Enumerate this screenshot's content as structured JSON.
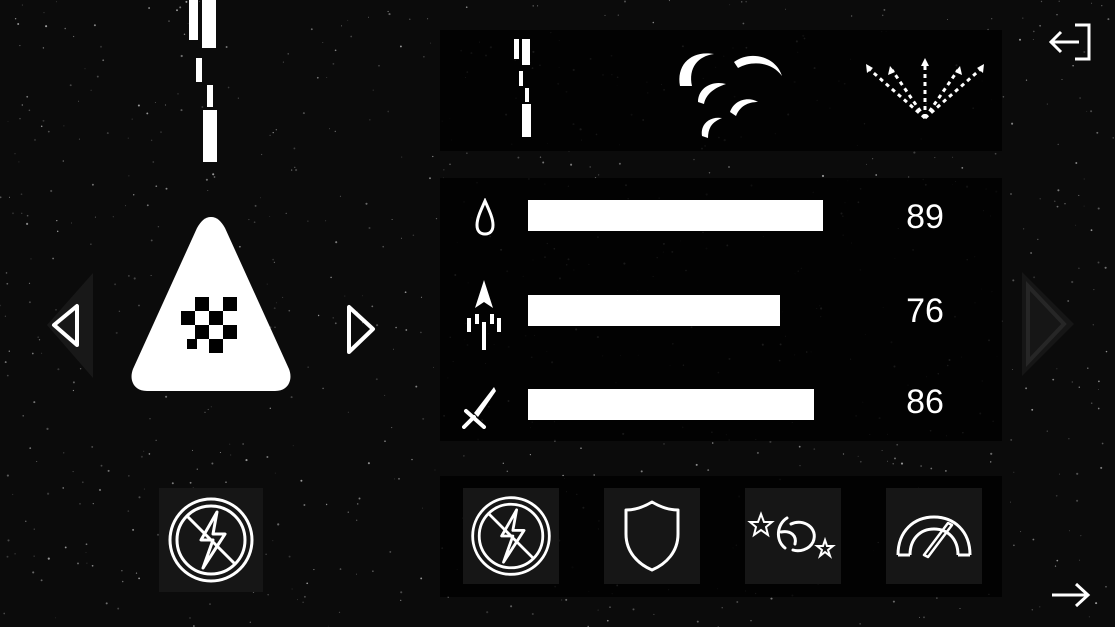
{
  "colors": {
    "background": "#0b0b0b",
    "panel": "#000000",
    "slot": "#161616",
    "foreground": "#ffffff"
  },
  "ship_selector": {
    "prev_icon": "triangle-left-outline-icon",
    "next_icon": "triangle-right-outline-icon",
    "ship_icon": "triangle-ship-checker-icon",
    "equipped_ability_icon": "no-lightning-icon"
  },
  "weapons": [
    {
      "name": "laser-stream-icon"
    },
    {
      "name": "crescent-burst-icon"
    },
    {
      "name": "arrow-spread-icon"
    }
  ],
  "stats": [
    {
      "icon": "droplet-icon",
      "fill": 0.89,
      "value": "89"
    },
    {
      "icon": "rocket-speed-icon",
      "fill": 0.76,
      "value": "76"
    },
    {
      "icon": "sword-icon",
      "fill": 0.86,
      "value": "86"
    }
  ],
  "abilities": [
    {
      "name": "no-lightning-icon"
    },
    {
      "name": "shield-icon"
    },
    {
      "name": "swirl-stars-icon"
    },
    {
      "name": "speedometer-icon"
    }
  ],
  "nav": {
    "exit_icon": "exit-icon",
    "next_icon": "arrow-right-icon"
  }
}
